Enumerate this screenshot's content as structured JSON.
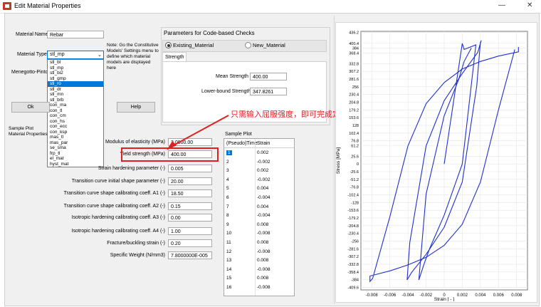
{
  "window": {
    "title": "Edit Material Properties",
    "minimize": "—",
    "close": "✕"
  },
  "material": {
    "name_label": "Material Name:",
    "name_value": "Rebar",
    "type_label": "Material Type:",
    "type_value": "stl_mp",
    "type_options": [
      "stl_bl",
      "stl_mp",
      "stl_bi2",
      "stl_gmp",
      "stl_ro",
      "stl_dr",
      "stl_mn",
      "stl_brb",
      "con_ma",
      "con_tl",
      "con_cm",
      "con_hs",
      "con_ecc",
      "con_ksp",
      "mas_tl",
      "mas_par",
      "se_sma",
      "frp_tl",
      "el_mat",
      "hyst_mat"
    ],
    "type_selected": "stl_ro",
    "model_label": "Menegotto-Pinto st",
    "note": "Note: Go the Constitutive Models' Settings menu to define which material models are displayed here"
  },
  "buttons": {
    "ok": "Ok",
    "help": "Help"
  },
  "sample_plot_label": "Sample Plot\nMaterial Properties",
  "checks": {
    "title": "Parameters for Code-based Checks",
    "radio_existing": "Existing_Material",
    "radio_new": "New_Material",
    "tab": "Strength",
    "mean_label": "Mean Strength",
    "mean_value": "400.00",
    "lower_label": "Lower-bound Strength",
    "lower_value": "347.8261"
  },
  "params": [
    {
      "label": "Modulus of elasticity (MPa)",
      "value": "2.0000.00"
    },
    {
      "label": "Yield strength (MPa)",
      "value": "400.00"
    },
    {
      "label": "Strain hardening parameter (-)",
      "value": "0.005"
    },
    {
      "label": "Transition curve initial shape parameter (-)",
      "value": "20.00"
    },
    {
      "label": "Transition curve shape calibrating coeff. A1 (-)",
      "value": "18.50"
    },
    {
      "label": "Transition curve shape calibrating coeff. A2 (-)",
      "value": "0.15"
    },
    {
      "label": "Isotropic hardening calibrating coeff. A3 (-)",
      "value": "0.00"
    },
    {
      "label": "Isotropic hardening calibrating coeff. A4 (-)",
      "value": "1.00"
    },
    {
      "label": "Fracture/buckling strain (-)",
      "value": "0.20"
    },
    {
      "label": "Specific Weight (N/mm3)",
      "value": "7.8000000E-005"
    }
  ],
  "sample_table": {
    "title": "Sample Plot",
    "headers": [
      "(Pseudo)Time",
      "Strain"
    ],
    "rows": [
      [
        "1",
        "0.002"
      ],
      [
        "2",
        "-0.002"
      ],
      [
        "3",
        "0.002"
      ],
      [
        "4",
        "-0.002"
      ],
      [
        "5",
        "0.004"
      ],
      [
        "6",
        "-0.004"
      ],
      [
        "7",
        "0.004"
      ],
      [
        "8",
        "-0.004"
      ],
      [
        "9",
        "0.008"
      ],
      [
        "10",
        "-0.008"
      ],
      [
        "11",
        "0.008"
      ],
      [
        "12",
        "-0.008"
      ],
      [
        "13",
        "0.008"
      ],
      [
        "14",
        "-0.008"
      ],
      [
        "15",
        "0.008"
      ],
      [
        "16",
        "-0.008"
      ]
    ]
  },
  "annotation": "只需输入屈服强度，即可完成定义",
  "colors": {
    "curve": "#1f2fd0",
    "annotation": "#e02020",
    "selection": "#0078d7"
  },
  "chart_data": {
    "type": "line",
    "xlabel": "Strain [ - ]",
    "ylabel": "Stress [MPa]",
    "xlim": [
      -0.0092,
      0.0092
    ],
    "ylim": [
      -418,
      440
    ],
    "xticks": [
      "-0.008",
      "-0.006",
      "-0.004",
      "-0.002",
      "0",
      "0.002",
      "0.004",
      "0.006",
      "0.008"
    ],
    "yticks": [
      "436.2",
      "400.4",
      "384",
      "368.4",
      "332.8",
      "307.2",
      "281.6",
      "256",
      "230.4",
      "204.8",
      "179.2",
      "153.6",
      "128",
      "102.4",
      "76.8",
      "61.2",
      "25.6",
      "0",
      "-25.6",
      "-51.2",
      "-76.8",
      "-102.4",
      "-128",
      "-153.6",
      "-179.2",
      "-204.8",
      "-230.4",
      "-256",
      "-281.6",
      "-307.2",
      "-332.8",
      "-358.4",
      "-384",
      "-409.6"
    ],
    "grid": true,
    "series": [
      {
        "x": [
          0,
          0.002,
          0.0022,
          0.0035,
          0.002,
          0.0,
          -0.0016,
          -0.0022,
          -0.0028,
          -0.002,
          0.0,
          0.0016,
          0.0022,
          0.003
        ],
        "y": [
          0,
          400,
          380,
          395,
          0,
          -170,
          -280,
          -330,
          -385,
          -100,
          160,
          280,
          340,
          385
        ]
      },
      {
        "x": [
          0.004,
          0.0036,
          0.002,
          0.0,
          -0.002,
          -0.0036,
          -0.0041,
          -0.0038,
          -0.002,
          0.0,
          0.002,
          0.0037,
          0.0041
        ],
        "y": [
          405,
          260,
          -60,
          -210,
          -300,
          -360,
          -385,
          -260,
          60,
          210,
          300,
          370,
          410
        ]
      },
      {
        "x": [
          0.0078,
          0.006,
          0.004,
          0.002,
          0.0,
          -0.002,
          -0.004,
          -0.006,
          -0.0082,
          -0.0082,
          -0.0079,
          -0.006,
          -0.004,
          -0.002,
          0.0,
          0.002,
          0.004,
          0.006,
          0.0082,
          0.0082
        ],
        "y": [
          380,
          180,
          -60,
          -200,
          -270,
          -310,
          -335,
          -355,
          -372,
          -390,
          -380,
          -175,
          60,
          200,
          270,
          315,
          340,
          358,
          372,
          388
        ]
      }
    ]
  }
}
